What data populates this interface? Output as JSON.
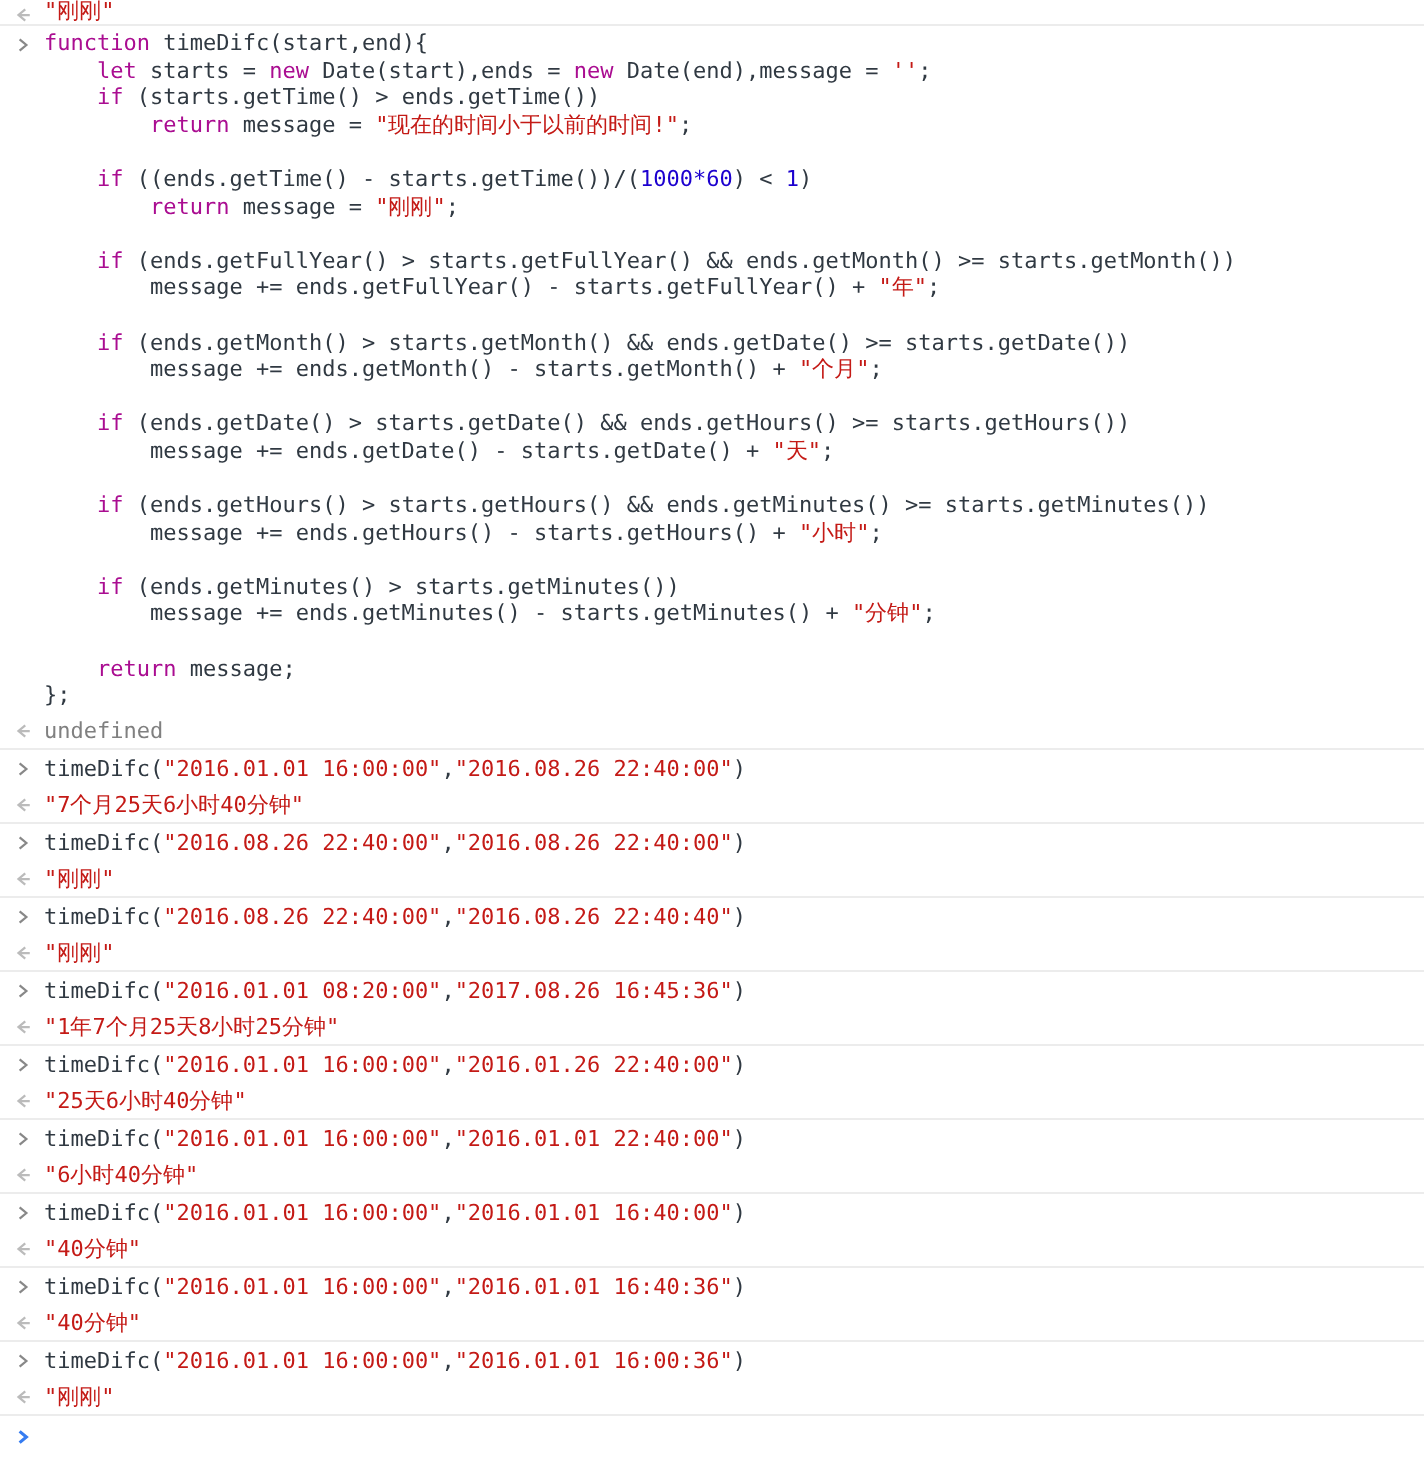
{
  "console": {
    "entries": [
      {
        "kind": "string_result",
        "text": "\"刚刚\""
      },
      {
        "kind": "input",
        "lines": [
          {
            "kind": "code",
            "tokens": [
              {
                "kind": "keyword",
                "text": "function"
              },
              {
                "kind": "plain",
                "text": " timeDifc(start,end){"
              }
            ]
          },
          {
            "kind": "code",
            "tokens": [
              {
                "kind": "keyword",
                "text": "    let"
              },
              {
                "kind": "plain",
                "text": " starts = "
              },
              {
                "kind": "keyword",
                "text": "new"
              },
              {
                "kind": "plain",
                "text": " Date(start),ends = "
              },
              {
                "kind": "keyword",
                "text": "new"
              },
              {
                "kind": "plain",
                "text": " Date(end),message = "
              },
              {
                "kind": "string",
                "text": "''"
              },
              {
                "kind": "plain",
                "text": ";"
              }
            ]
          },
          {
            "kind": "code",
            "tokens": [
              {
                "kind": "keyword",
                "text": "    if"
              },
              {
                "kind": "plain",
                "text": " (starts.getTime() > ends.getTime())"
              }
            ]
          },
          {
            "kind": "code",
            "tokens": [
              {
                "kind": "keyword",
                "text": "        return"
              },
              {
                "kind": "plain",
                "text": " message = "
              },
              {
                "kind": "string",
                "text": "\"现在的时间小于以前的时间!\""
              },
              {
                "kind": "plain",
                "text": ";"
              }
            ]
          },
          {
            "kind": "blank"
          },
          {
            "kind": "code",
            "tokens": [
              {
                "kind": "keyword",
                "text": "    if"
              },
              {
                "kind": "plain",
                "text": " ((ends.getTime() - starts.getTime())/("
              },
              {
                "kind": "number",
                "text": "1000*60"
              },
              {
                "kind": "plain",
                "text": ") < "
              },
              {
                "kind": "number",
                "text": "1"
              },
              {
                "kind": "plain",
                "text": ")"
              }
            ]
          },
          {
            "kind": "code",
            "tokens": [
              {
                "kind": "keyword",
                "text": "        return"
              },
              {
                "kind": "plain",
                "text": " message = "
              },
              {
                "kind": "string",
                "text": "\"刚刚\""
              },
              {
                "kind": "plain",
                "text": ";"
              }
            ]
          },
          {
            "kind": "blank"
          },
          {
            "kind": "code",
            "tokens": [
              {
                "kind": "keyword",
                "text": "    if"
              },
              {
                "kind": "plain",
                "text": " (ends.getFullYear() > starts.getFullYear() && ends.getMonth() >= starts.getMonth())"
              }
            ]
          },
          {
            "kind": "code",
            "tokens": [
              {
                "kind": "plain",
                "text": "        message += ends.getFullYear() - starts.getFullYear() + "
              },
              {
                "kind": "string",
                "text": "\"年\""
              },
              {
                "kind": "plain",
                "text": ";"
              }
            ]
          },
          {
            "kind": "blank"
          },
          {
            "kind": "code",
            "tokens": [
              {
                "kind": "keyword",
                "text": "    if"
              },
              {
                "kind": "plain",
                "text": " (ends.getMonth() > starts.getMonth() && ends.getDate() >= starts.getDate())"
              }
            ]
          },
          {
            "kind": "code",
            "tokens": [
              {
                "kind": "plain",
                "text": "        message += ends.getMonth() - starts.getMonth() + "
              },
              {
                "kind": "string",
                "text": "\"个月\""
              },
              {
                "kind": "plain",
                "text": ";"
              }
            ]
          },
          {
            "kind": "blank"
          },
          {
            "kind": "code",
            "tokens": [
              {
                "kind": "keyword",
                "text": "    if"
              },
              {
                "kind": "plain",
                "text": " (ends.getDate() > starts.getDate() && ends.getHours() >= starts.getHours())"
              }
            ]
          },
          {
            "kind": "code",
            "tokens": [
              {
                "kind": "plain",
                "text": "        message += ends.getDate() - starts.getDate() + "
              },
              {
                "kind": "string",
                "text": "\"天\""
              },
              {
                "kind": "plain",
                "text": ";"
              }
            ]
          },
          {
            "kind": "blank"
          },
          {
            "kind": "code",
            "tokens": [
              {
                "kind": "keyword",
                "text": "    if"
              },
              {
                "kind": "plain",
                "text": " (ends.getHours() > starts.getHours() && ends.getMinutes() >= starts.getMinutes())"
              }
            ]
          },
          {
            "kind": "code",
            "tokens": [
              {
                "kind": "plain",
                "text": "        message += ends.getHours() - starts.getHours() + "
              },
              {
                "kind": "string",
                "text": "\"小时\""
              },
              {
                "kind": "plain",
                "text": ";"
              }
            ]
          },
          {
            "kind": "blank"
          },
          {
            "kind": "code",
            "tokens": [
              {
                "kind": "keyword",
                "text": "    if"
              },
              {
                "kind": "plain",
                "text": " (ends.getMinutes() > starts.getMinutes())"
              }
            ]
          },
          {
            "kind": "code",
            "tokens": [
              {
                "kind": "plain",
                "text": "        message += ends.getMinutes() - starts.getMinutes() + "
              },
              {
                "kind": "string",
                "text": "\"分钟\""
              },
              {
                "kind": "plain",
                "text": ";"
              }
            ]
          },
          {
            "kind": "blank"
          },
          {
            "kind": "code",
            "tokens": [
              {
                "kind": "keyword",
                "text": "    return"
              },
              {
                "kind": "plain",
                "text": " message;"
              }
            ]
          },
          {
            "kind": "code",
            "tokens": [
              {
                "kind": "plain",
                "text": "};"
              }
            ]
          }
        ]
      },
      {
        "kind": "undefined_result",
        "text": "undefined"
      },
      {
        "kind": "input",
        "lines": [
          {
            "kind": "code",
            "tokens": [
              {
                "kind": "plain",
                "text": "timeDifc("
              },
              {
                "kind": "string",
                "text": "\"2016.01.01 16:00:00\""
              },
              {
                "kind": "plain",
                "text": ","
              },
              {
                "kind": "string",
                "text": "\"2016.08.26 22:40:00\""
              },
              {
                "kind": "plain",
                "text": ")"
              }
            ]
          }
        ]
      },
      {
        "kind": "string_result",
        "text": "\"7个月25天6小时40分钟\""
      },
      {
        "kind": "input",
        "lines": [
          {
            "kind": "code",
            "tokens": [
              {
                "kind": "plain",
                "text": "timeDifc("
              },
              {
                "kind": "string",
                "text": "\"2016.08.26 22:40:00\""
              },
              {
                "kind": "plain",
                "text": ","
              },
              {
                "kind": "string",
                "text": "\"2016.08.26 22:40:00\""
              },
              {
                "kind": "plain",
                "text": ")"
              }
            ]
          }
        ]
      },
      {
        "kind": "string_result",
        "text": "\"刚刚\""
      },
      {
        "kind": "input",
        "lines": [
          {
            "kind": "code",
            "tokens": [
              {
                "kind": "plain",
                "text": "timeDifc("
              },
              {
                "kind": "string",
                "text": "\"2016.08.26 22:40:00\""
              },
              {
                "kind": "plain",
                "text": ","
              },
              {
                "kind": "string",
                "text": "\"2016.08.26 22:40:40\""
              },
              {
                "kind": "plain",
                "text": ")"
              }
            ]
          }
        ]
      },
      {
        "kind": "string_result",
        "text": "\"刚刚\""
      },
      {
        "kind": "input",
        "lines": [
          {
            "kind": "code",
            "tokens": [
              {
                "kind": "plain",
                "text": "timeDifc("
              },
              {
                "kind": "string",
                "text": "\"2016.01.01 08:20:00\""
              },
              {
                "kind": "plain",
                "text": ","
              },
              {
                "kind": "string",
                "text": "\"2017.08.26 16:45:36\""
              },
              {
                "kind": "plain",
                "text": ")"
              }
            ]
          }
        ]
      },
      {
        "kind": "string_result",
        "text": "\"1年7个月25天8小时25分钟\""
      },
      {
        "kind": "input",
        "lines": [
          {
            "kind": "code",
            "tokens": [
              {
                "kind": "plain",
                "text": "timeDifc("
              },
              {
                "kind": "string",
                "text": "\"2016.01.01 16:00:00\""
              },
              {
                "kind": "plain",
                "text": ","
              },
              {
                "kind": "string",
                "text": "\"2016.01.26 22:40:00\""
              },
              {
                "kind": "plain",
                "text": ")"
              }
            ]
          }
        ]
      },
      {
        "kind": "string_result",
        "text": "\"25天6小时40分钟\""
      },
      {
        "kind": "input",
        "lines": [
          {
            "kind": "code",
            "tokens": [
              {
                "kind": "plain",
                "text": "timeDifc("
              },
              {
                "kind": "string",
                "text": "\"2016.01.01 16:00:00\""
              },
              {
                "kind": "plain",
                "text": ","
              },
              {
                "kind": "string",
                "text": "\"2016.01.01 22:40:00\""
              },
              {
                "kind": "plain",
                "text": ")"
              }
            ]
          }
        ]
      },
      {
        "kind": "string_result",
        "text": "\"6小时40分钟\""
      },
      {
        "kind": "input",
        "lines": [
          {
            "kind": "code",
            "tokens": [
              {
                "kind": "plain",
                "text": "timeDifc("
              },
              {
                "kind": "string",
                "text": "\"2016.01.01 16:00:00\""
              },
              {
                "kind": "plain",
                "text": ","
              },
              {
                "kind": "string",
                "text": "\"2016.01.01 16:40:00\""
              },
              {
                "kind": "plain",
                "text": ")"
              }
            ]
          }
        ]
      },
      {
        "kind": "string_result",
        "text": "\"40分钟\""
      },
      {
        "kind": "input",
        "lines": [
          {
            "kind": "code",
            "tokens": [
              {
                "kind": "plain",
                "text": "timeDifc("
              },
              {
                "kind": "string",
                "text": "\"2016.01.01 16:00:00\""
              },
              {
                "kind": "plain",
                "text": ","
              },
              {
                "kind": "string",
                "text": "\"2016.01.01 16:40:36\""
              },
              {
                "kind": "plain",
                "text": ")"
              }
            ]
          }
        ]
      },
      {
        "kind": "string_result",
        "text": "\"40分钟\""
      },
      {
        "kind": "input",
        "lines": [
          {
            "kind": "code",
            "tokens": [
              {
                "kind": "plain",
                "text": "timeDifc("
              },
              {
                "kind": "string",
                "text": "\"2016.01.01 16:00:00\""
              },
              {
                "kind": "plain",
                "text": ","
              },
              {
                "kind": "string",
                "text": "\"2016.01.01 16:00:36\""
              },
              {
                "kind": "plain",
                "text": ")"
              }
            ]
          }
        ]
      },
      {
        "kind": "string_result",
        "text": "\"刚刚\""
      },
      {
        "kind": "prompt"
      }
    ]
  }
}
